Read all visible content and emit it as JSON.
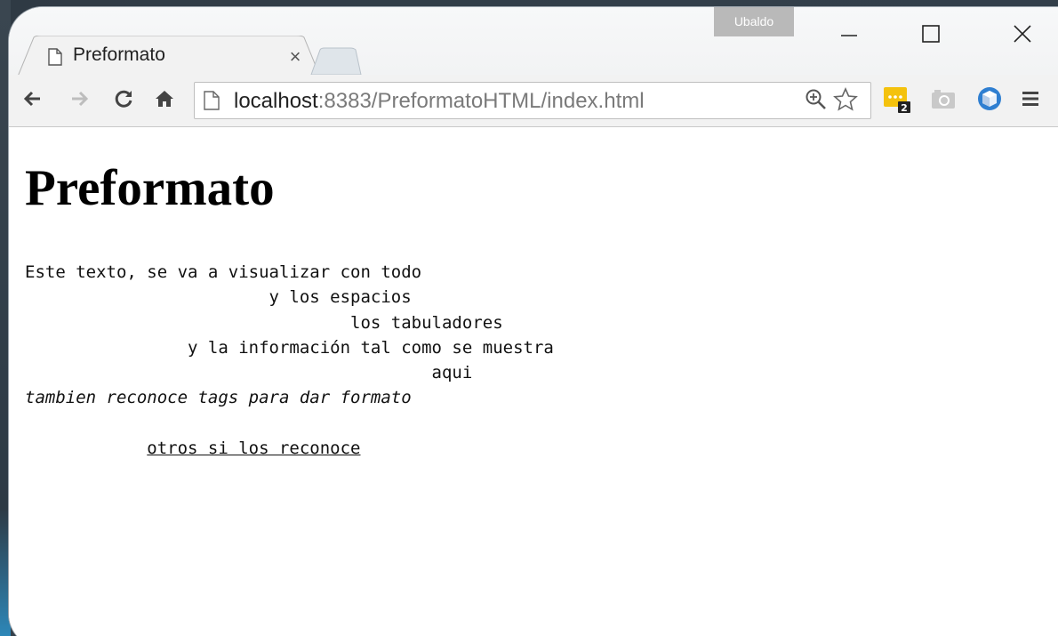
{
  "browser": {
    "profile_name": "Ubaldo",
    "tab": {
      "title": "Preformato",
      "close_glyph": "×"
    },
    "omnibox": {
      "url_host": "localhost",
      "url_rest": ":8383/PreformatoHTML/index.html"
    },
    "icons": {
      "back": "back-arrow-icon",
      "forward": "forward-arrow-icon",
      "reload": "reload-icon",
      "home": "home-icon",
      "page": "page-icon",
      "zoom": "zoom-icon",
      "bookmark": "star-icon",
      "extension_badge_count": "2",
      "menu": "hamburger-menu-icon"
    },
    "colors": {
      "extension_yellow": "#f4c20d",
      "extension_blue": "#2f7fd1",
      "profile_badge": "#b9b9b9"
    }
  },
  "page": {
    "heading": "Preformato",
    "pre_lines": [
      "Este texto, se va a visualizar con todo",
      "                        y los espacios",
      "                                los tabuladores",
      "                y la información tal como se muestra",
      "                                        aqui"
    ],
    "italic_line": "tambien reconoce tags para dar formato",
    "underline_indent": "            ",
    "underline_text": "otros si los reconoce"
  }
}
